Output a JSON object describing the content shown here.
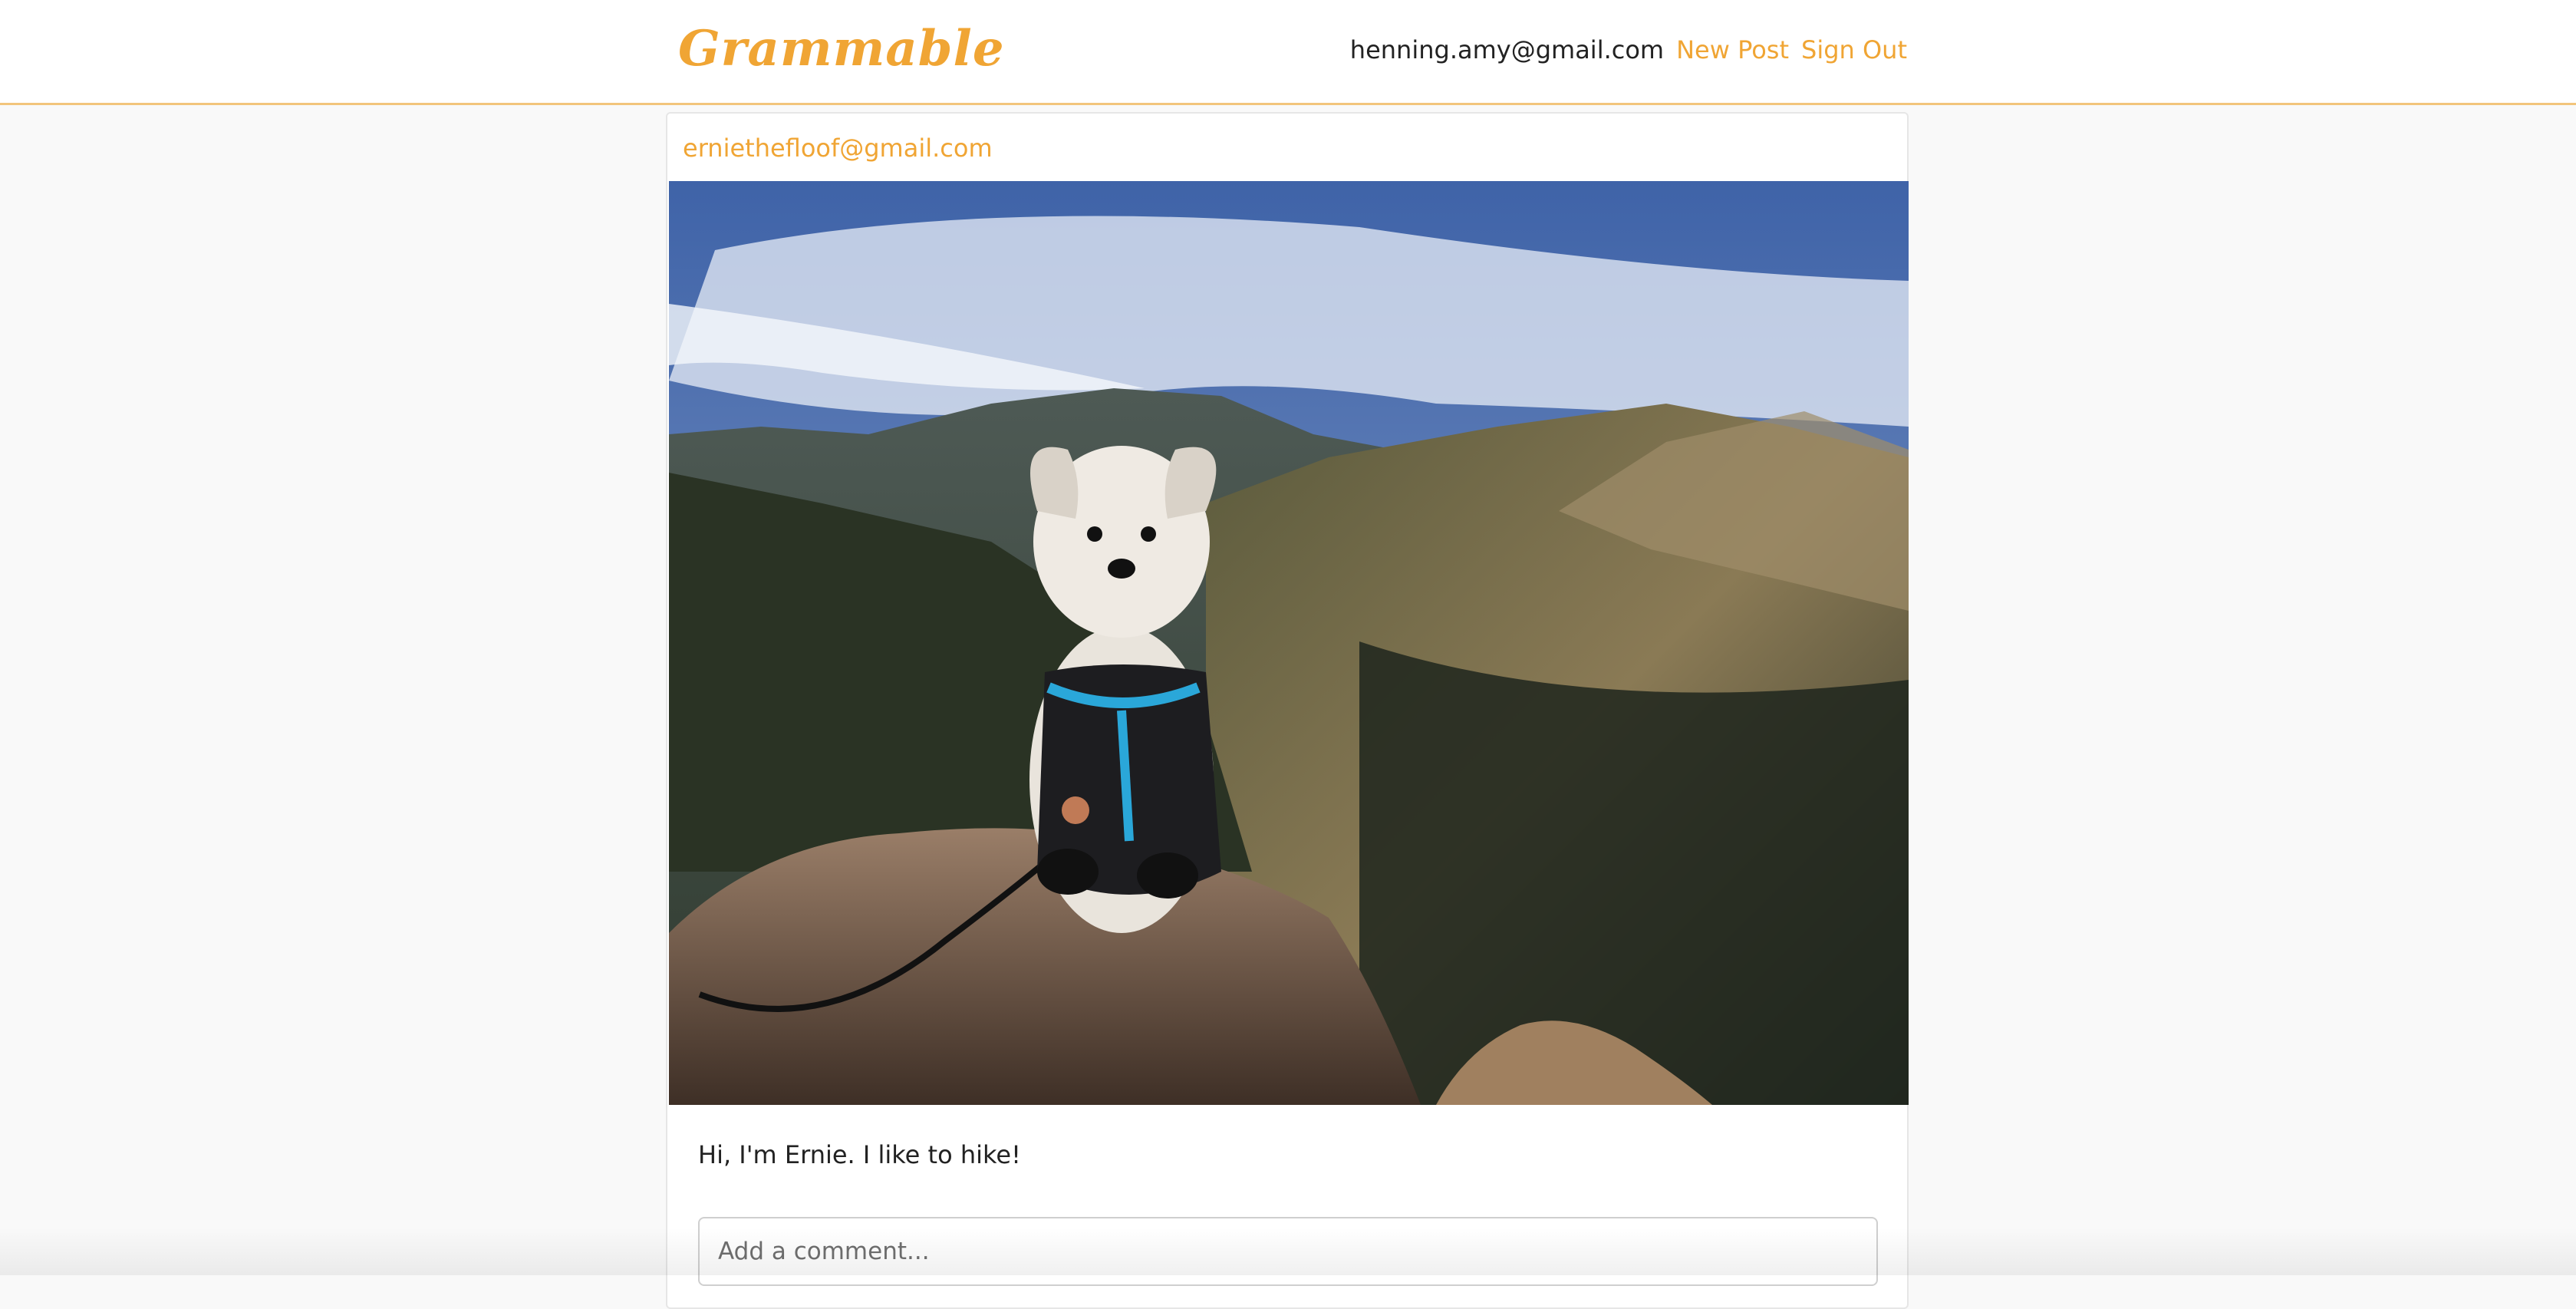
{
  "header": {
    "brand": "Grammable",
    "user_email": "henning.amy@gmail.com",
    "new_post_label": "New Post",
    "sign_out_label": "Sign Out"
  },
  "post": {
    "author": "erniethefloof@gmail.com",
    "caption": "Hi, I'm Ernie. I like to hike!",
    "comment_placeholder": "Add a comment..."
  },
  "colors": {
    "accent": "#f0a534",
    "header_border": "#f2c57c",
    "background": "#f9f9f9"
  }
}
